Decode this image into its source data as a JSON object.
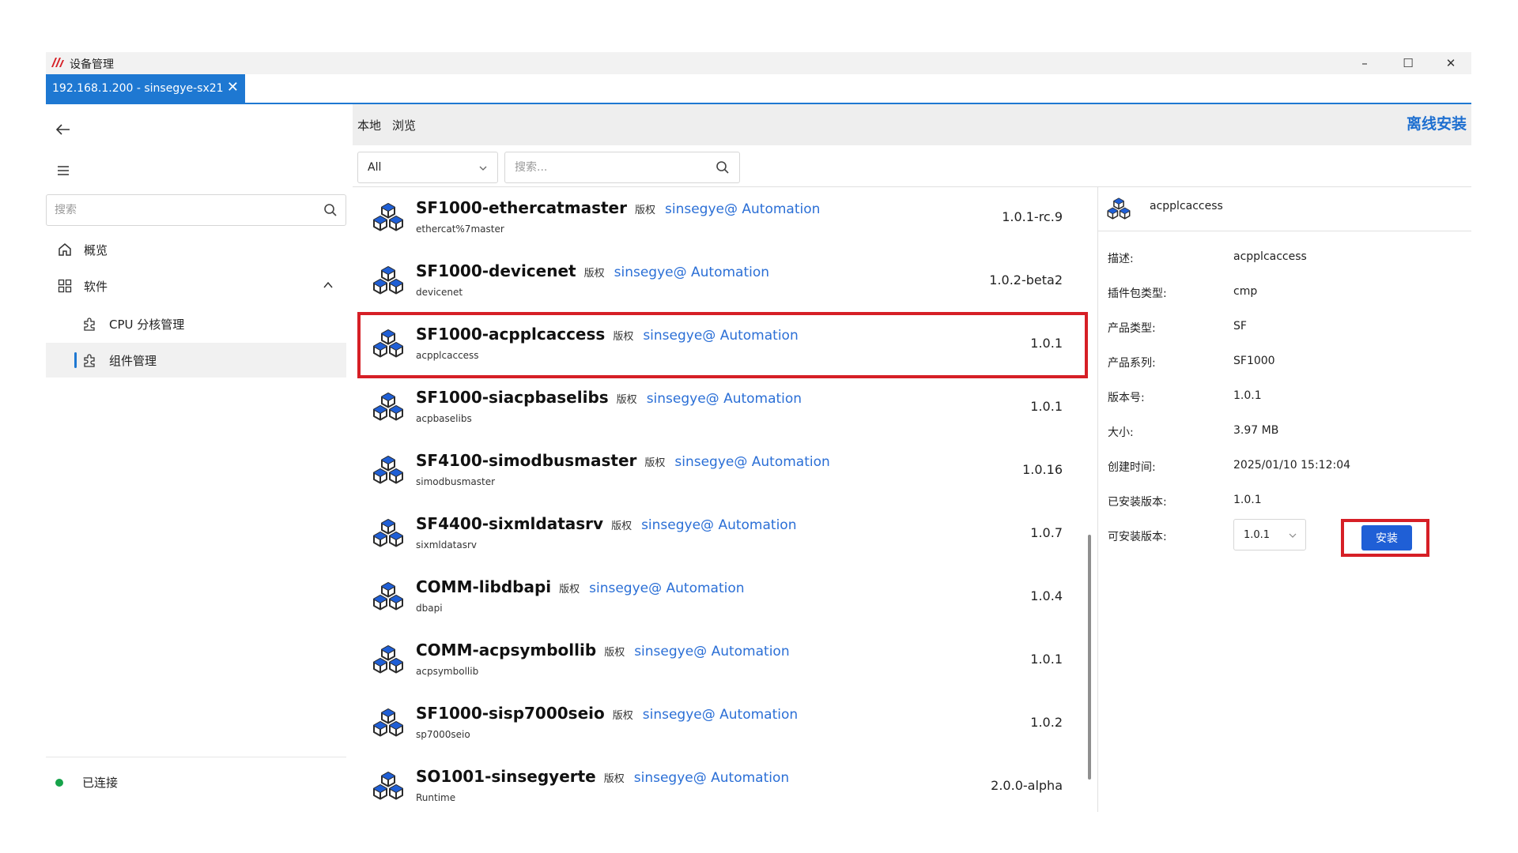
{
  "app": {
    "title": "设备管理"
  },
  "window_controls": {
    "minimize": "–",
    "maximize": "☐",
    "close": "✕"
  },
  "connection_tab": {
    "label": "192.168.1.200 - sinsegye-sx21",
    "close": "✕"
  },
  "sidebar": {
    "search_placeholder": "搜索",
    "items": [
      {
        "label": "概览",
        "icon": "home-icon"
      },
      {
        "label": "软件",
        "icon": "grid-icon"
      },
      {
        "label": "CPU 分核管理",
        "icon": "puzzle-icon"
      },
      {
        "label": "组件管理",
        "icon": "puzzle-icon"
      }
    ],
    "status": "已连接"
  },
  "main": {
    "tabs": [
      "本地",
      "浏览"
    ],
    "offline_install": "离线安装",
    "filter_value": "All",
    "search_placeholder": "搜索..."
  },
  "packages": [
    {
      "name": "SF1000-ethercatmaster",
      "copyright": "版权",
      "vendor": "sinsegye@ Automation",
      "sub": "ethercat%7master",
      "version": "1.0.1-rc.9"
    },
    {
      "name": "SF1000-devicenet",
      "copyright": "版权",
      "vendor": "sinsegye@ Automation",
      "sub": "devicenet",
      "version": "1.0.2-beta2"
    },
    {
      "name": "SF1000-acpplcaccess",
      "copyright": "版权",
      "vendor": "sinsegye@ Automation",
      "sub": "acpplcaccess",
      "version": "1.0.1"
    },
    {
      "name": "SF1000-siacpbaselibs",
      "copyright": "版权",
      "vendor": "sinsegye@ Automation",
      "sub": "acpbaselibs",
      "version": "1.0.1"
    },
    {
      "name": "SF4100-simodbusmaster",
      "copyright": "版权",
      "vendor": "sinsegye@ Automation",
      "sub": "simodbusmaster",
      "version": "1.0.16"
    },
    {
      "name": "SF4400-sixmldatasrv",
      "copyright": "版权",
      "vendor": "sinsegye@ Automation",
      "sub": "sixmldatasrv",
      "version": "1.0.7"
    },
    {
      "name": "COMM-libdbapi",
      "copyright": "版权",
      "vendor": "sinsegye@ Automation",
      "sub": "dbapi",
      "version": "1.0.4"
    },
    {
      "name": "COMM-acpsymbollib",
      "copyright": "版权",
      "vendor": "sinsegye@ Automation",
      "sub": "acpsymbollib",
      "version": "1.0.1"
    },
    {
      "name": "SF1000-sisp7000seio",
      "copyright": "版权",
      "vendor": "sinsegye@ Automation",
      "sub": "sp7000seio",
      "version": "1.0.2"
    },
    {
      "name": "SO1001-sinsegyerte",
      "copyright": "版权",
      "vendor": "sinsegye@ Automation",
      "sub": "Runtime",
      "version": "2.0.0-alpha"
    }
  ],
  "detail": {
    "title": "acpplcaccess",
    "fields": [
      {
        "label": "描述:",
        "value": "acpplcaccess"
      },
      {
        "label": "插件包类型:",
        "value": "cmp"
      },
      {
        "label": "产品类型:",
        "value": "SF"
      },
      {
        "label": "产品系列:",
        "value": "SF1000"
      },
      {
        "label": "版本号:",
        "value": "1.0.1"
      },
      {
        "label": "大小:",
        "value": "3.97 MB"
      },
      {
        "label": "创建时间:",
        "value": "2025/01/10 15:12:04"
      },
      {
        "label": "已安装版本:",
        "value": "1.0.1"
      },
      {
        "label": "可安装版本:",
        "value": ""
      }
    ],
    "installable_version": "1.0.1",
    "install_label": "安装"
  },
  "colors": {
    "accent": "#1e78d2",
    "link": "#2b6fd6",
    "highlight": "#d61f26",
    "connected": "#16a34a"
  }
}
